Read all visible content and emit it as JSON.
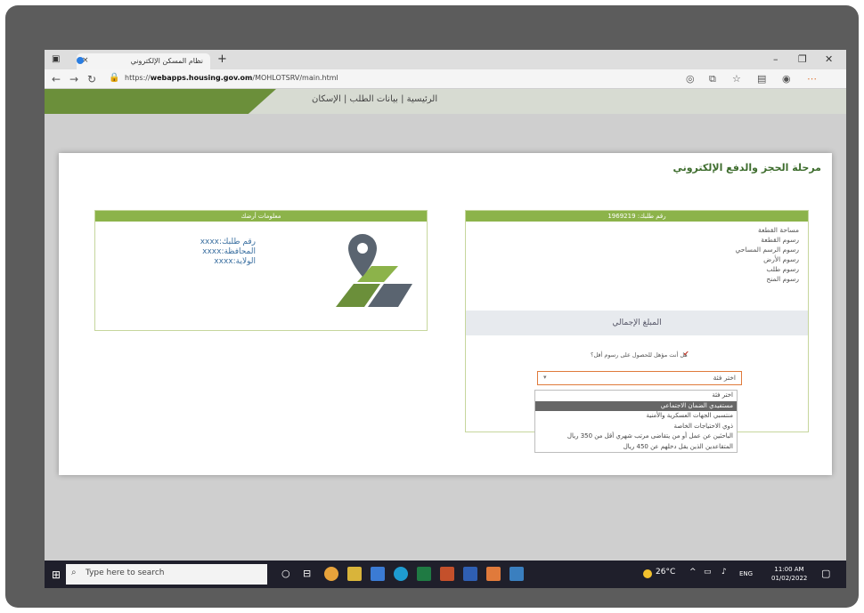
{
  "browser": {
    "tab_title": "نظام المسكن الإلكتروني",
    "tab_close": "×",
    "new_tab": "+",
    "url_prefix": "https://",
    "url_host": "webapps.housing.gov.om",
    "url_path": "/MOHLOTSRV/main.html"
  },
  "page": {
    "header_title": "الرئيسية | بيانات الطلب | الإسكان"
  },
  "modal": {
    "title": "مرحلة الحجز والدفع الإلكتروني",
    "left_panel": {
      "header": "معلومات أرضك",
      "lines": [
        "رقم طلبك:xxxx",
        "المحافظة:xxxx",
        "الولاية:xxxx"
      ]
    },
    "right_panel": {
      "header": "رقم طلبك: 1969219",
      "fees": [
        "مساحة القطعة",
        "رسوم القطعة",
        "رسوم الرسم المساحي",
        "رسوم الأرض",
        "رسوم طلب",
        "رسوم المنح"
      ],
      "total_label": "المبلغ الإجمالي",
      "question": "هل أنت مؤهل للحصول على رسوم أقل؟",
      "select_value": "اختر فئة"
    },
    "dropdown": {
      "options": [
        "اختر فئة",
        "مستفيدي الضمان الاجتماعي",
        "منتسبي الجهات العسكرية والأمنية",
        "ذوي الاحتياجات الخاصة",
        "الباحثين عن عمل أو من يتقاضى مرتب شهري أقل من 350 ريال",
        "المتقاعدين الذين يقل دخلهم عن 450 ريال"
      ],
      "selected_index": 1
    }
  },
  "taskbar": {
    "search_placeholder": "Type here to search",
    "weather": "26°C",
    "lang": "ENG",
    "time": "11:00 AM",
    "date": "01/02/2022"
  },
  "colors": {
    "accent_green": "#8cb34a",
    "title_green": "#3e6d2e",
    "select_border": "#e07a3b"
  }
}
